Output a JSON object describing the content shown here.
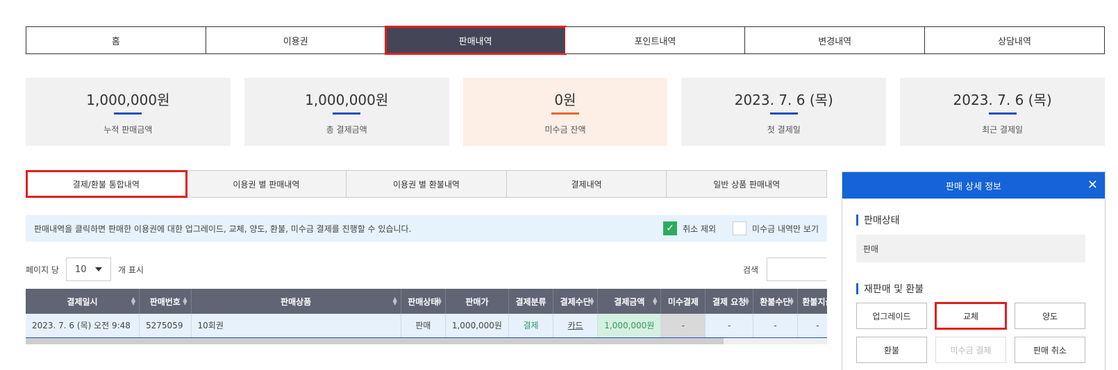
{
  "nav": {
    "items": [
      {
        "label": "홈"
      },
      {
        "label": "이용권"
      },
      {
        "label": "판매내역"
      },
      {
        "label": "포인트내역"
      },
      {
        "label": "변경내역"
      },
      {
        "label": "상담내역"
      }
    ],
    "active_index": 2
  },
  "stats": [
    {
      "value": "1,000,000원",
      "label": "누적 판매금액"
    },
    {
      "value": "1,000,000원",
      "label": "총 결제금액"
    },
    {
      "value": "0원",
      "label": "미수금 잔액"
    },
    {
      "value": "2023. 7. 6 (목)",
      "label": "첫 결제일"
    },
    {
      "value": "2023. 7. 6 (목)",
      "label": "최근 결제일"
    }
  ],
  "subtabs": [
    {
      "label": "결제/환불 통합내역"
    },
    {
      "label": "이용권 별 판매내역"
    },
    {
      "label": "이용권 별 환불내역"
    },
    {
      "label": "결제내역"
    },
    {
      "label": "일반 상품 판매내역"
    }
  ],
  "notice": {
    "message": "판매내역을 클릭하면 판매한 이용권에 대한 업그레이드, 교체, 양도, 환불, 미수금 결제를 진행할 수 있습니다.",
    "exclude_cancel_label": "취소 제외",
    "exclude_cancel_checked": true,
    "unpaid_only_label": "미수금 내역만 보기",
    "unpaid_only_checked": false
  },
  "paging": {
    "prefix": "페이지 당",
    "page_size": "10",
    "suffix": "개 표시",
    "search_label": "검색"
  },
  "table": {
    "headers": [
      "결제일시",
      "판매번호",
      "판매상품",
      "판매상태",
      "판매가",
      "결제분류",
      "결제수단",
      "결제금액",
      "미수결제",
      "결제 요청",
      "환불수단",
      "환불지급"
    ],
    "rows": [
      [
        "2023. 7. 6 (목) 오전 9:48",
        "5275059",
        "10회권",
        "판매",
        "1,000,000원",
        "결제",
        "카드",
        "1,000,000원",
        "-",
        "-",
        "-",
        "-"
      ]
    ]
  },
  "panel": {
    "title": "판매 상세 정보",
    "status_title": "판매상태",
    "status_value": "판매",
    "actions_title": "재판매 및 환불",
    "buttons": [
      "업그레이드",
      "교체",
      "양도",
      "환불",
      "미수금 결제",
      "판매 취소"
    ]
  }
}
